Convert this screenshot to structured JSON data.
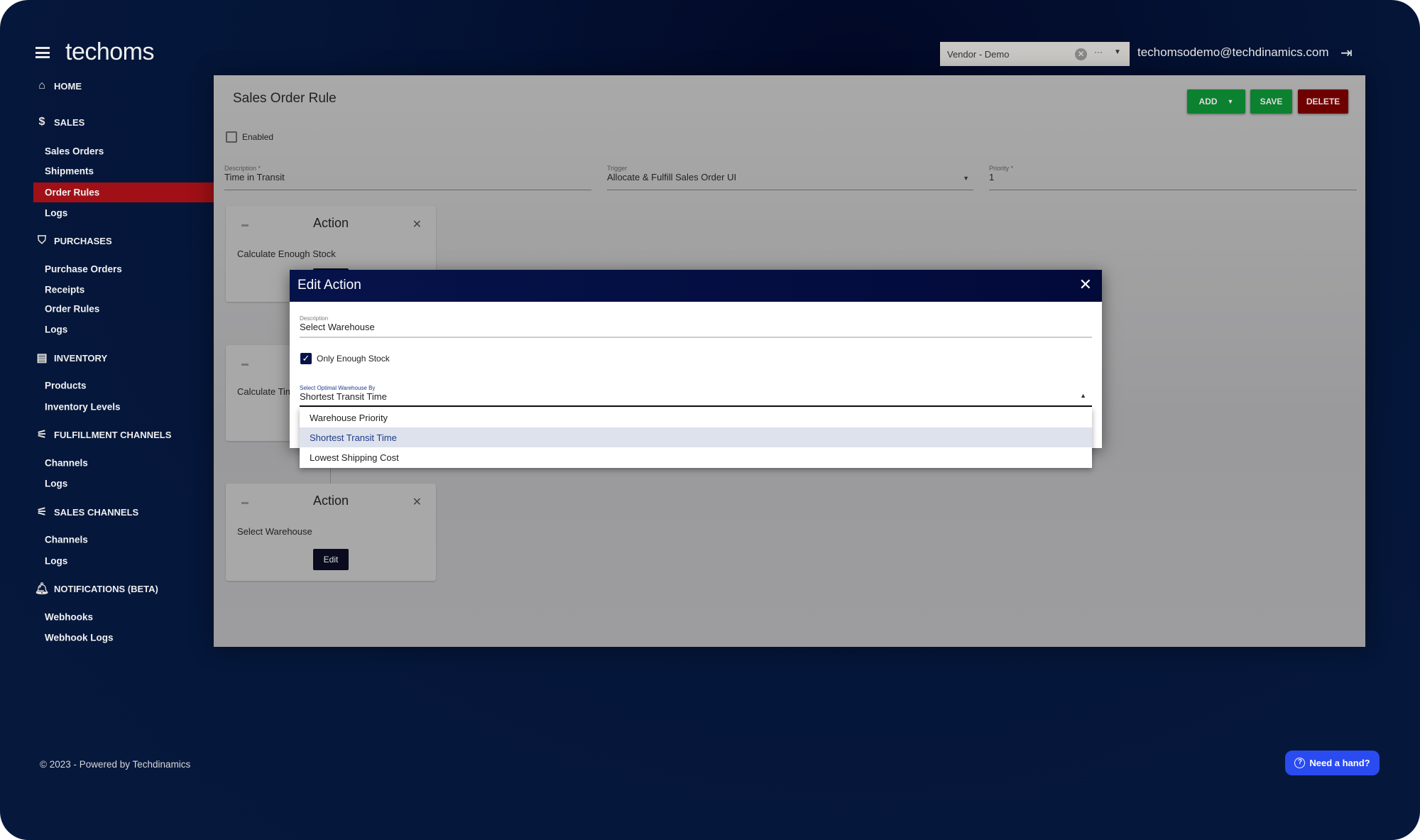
{
  "app": {
    "logo": "techoms",
    "menu_icon": "hamburger-icon"
  },
  "header": {
    "vendor_select": "Vendor - Demo",
    "email": "techomsodemo@techdinamics.com"
  },
  "sidebar": {
    "home": "HOME",
    "sales": {
      "label": "SALES",
      "items": [
        "Sales Orders",
        "Shipments",
        "Order Rules",
        "Logs"
      ]
    },
    "purchases": {
      "label": "PURCHASES",
      "items": [
        "Purchase Orders",
        "Receipts",
        "Order Rules",
        "Logs"
      ]
    },
    "inventory": {
      "label": "INVENTORY",
      "items": [
        "Products",
        "Inventory Levels"
      ]
    },
    "fulfillment": {
      "label": "FULFILLMENT CHANNELS",
      "items": [
        "Channels",
        "Logs"
      ]
    },
    "sales_channels": {
      "label": "SALES CHANNELS",
      "items": [
        "Channels",
        "Logs"
      ]
    },
    "notifications": {
      "label": "NOTIFICATIONS (BETA)",
      "items": [
        "Webhooks",
        "Webhook Logs"
      ]
    }
  },
  "page": {
    "title": "Sales Order Rule",
    "add": "ADD",
    "save": "SAVE",
    "delete": "DELETE",
    "enabled": "Enabled",
    "description_label": "Description *",
    "description_value": "Time in Transit",
    "trigger_label": "Trigger",
    "trigger_value": "Allocate & Fulfill Sales Order UI",
    "priority_label": "Priority *",
    "priority_value": "1",
    "cards": [
      {
        "title": "Action",
        "text": "Calculate Enough Stock"
      },
      {
        "title": "",
        "text": "Calculate Tim"
      },
      {
        "title": "Action",
        "text": "Select Warehouse",
        "edit": "Edit"
      }
    ]
  },
  "modal": {
    "title": "Edit Action",
    "description_label": "Description",
    "description_value": "Select Warehouse",
    "only_enough_stock": "Only Enough Stock",
    "only_enough_stock_checked": true,
    "select_label": "Select Optimal Warehouse By",
    "select_value": "Shortest Transit Time",
    "options": [
      "Warehouse Priority",
      "Shortest Transit Time",
      "Lowest Shipping Cost"
    ],
    "highlighted_option": "Shortest Transit Time"
  },
  "footer": {
    "copyright": "© 2023 - Powered by Techdinamics",
    "help": "Need a hand?"
  },
  "colors": {
    "active_nav": "#a01016",
    "add_save": "#0c8130",
    "delete": "#6e0000",
    "modal_header": "#06134a",
    "help": "#2a4bf0"
  }
}
